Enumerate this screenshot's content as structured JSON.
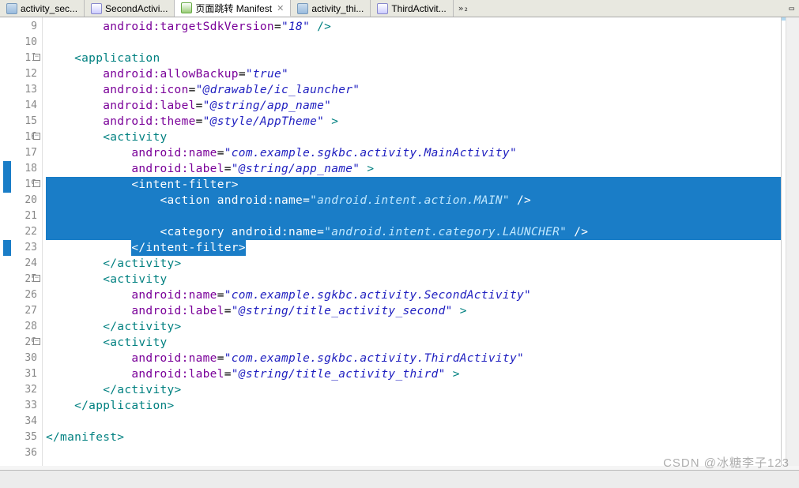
{
  "tabs": [
    {
      "label": "activity_sec...",
      "iconClass": "icon-xml",
      "active": false
    },
    {
      "label": "SecondActivi...",
      "iconClass": "icon-java",
      "active": false
    },
    {
      "label": "页面跳转 Manifest",
      "iconClass": "icon-manifest",
      "active": true,
      "closable": true
    },
    {
      "label": "activity_thi...",
      "iconClass": "icon-xml",
      "active": false
    },
    {
      "label": "ThirdActivit...",
      "iconClass": "icon-java",
      "active": false
    }
  ],
  "overflow_indicator": "»₂",
  "line_start": 9,
  "line_end": 36,
  "fold_lines": [
    11,
    16,
    19,
    25,
    29
  ],
  "blue_markers": [
    18,
    19,
    23
  ],
  "editor": {
    "lines": [
      {
        "n": 9,
        "indent": 2,
        "sel": false,
        "tokens": [
          {
            "t": "attr",
            "v": "android:targetSdkVersion"
          },
          {
            "t": "eq",
            "v": "="
          },
          {
            "t": "str",
            "v": "\"18\""
          },
          {
            "t": "tag",
            "v": " />"
          }
        ]
      },
      {
        "n": 10,
        "indent": 0,
        "sel": false,
        "tokens": []
      },
      {
        "n": 11,
        "indent": 1,
        "sel": false,
        "tokens": [
          {
            "t": "tag",
            "v": "<application"
          }
        ]
      },
      {
        "n": 12,
        "indent": 2,
        "sel": false,
        "tokens": [
          {
            "t": "attr",
            "v": "android:allowBackup"
          },
          {
            "t": "eq",
            "v": "="
          },
          {
            "t": "str",
            "v": "\"true\""
          }
        ]
      },
      {
        "n": 13,
        "indent": 2,
        "sel": false,
        "tokens": [
          {
            "t": "attr",
            "v": "android:icon"
          },
          {
            "t": "eq",
            "v": "="
          },
          {
            "t": "str",
            "v": "\"@drawable/ic_launcher\""
          }
        ]
      },
      {
        "n": 14,
        "indent": 2,
        "sel": false,
        "tokens": [
          {
            "t": "attr",
            "v": "android:label"
          },
          {
            "t": "eq",
            "v": "="
          },
          {
            "t": "str",
            "v": "\"@string/app_name\""
          }
        ]
      },
      {
        "n": 15,
        "indent": 2,
        "sel": false,
        "tokens": [
          {
            "t": "attr",
            "v": "android:theme"
          },
          {
            "t": "eq",
            "v": "="
          },
          {
            "t": "str",
            "v": "\"@style/AppTheme\""
          },
          {
            "t": "tag",
            "v": " >"
          }
        ]
      },
      {
        "n": 16,
        "indent": 2,
        "sel": false,
        "tokens": [
          {
            "t": "tag",
            "v": "<activity"
          }
        ]
      },
      {
        "n": 17,
        "indent": 3,
        "sel": false,
        "tokens": [
          {
            "t": "attr",
            "v": "android:name"
          },
          {
            "t": "eq",
            "v": "="
          },
          {
            "t": "str",
            "v": "\"com.example.sgkbc.activity.MainActivity\""
          }
        ]
      },
      {
        "n": 18,
        "indent": 3,
        "sel": false,
        "tokens": [
          {
            "t": "attr",
            "v": "android:label"
          },
          {
            "t": "eq",
            "v": "="
          },
          {
            "t": "str",
            "v": "\"@string/app_name\""
          },
          {
            "t": "tag",
            "v": " >"
          }
        ]
      },
      {
        "n": 19,
        "indent": 3,
        "sel": true,
        "tokens": [
          {
            "t": "tag",
            "v": "<intent-filter>"
          }
        ]
      },
      {
        "n": 20,
        "indent": 4,
        "sel": true,
        "tokens": [
          {
            "t": "tag",
            "v": "<action "
          },
          {
            "t": "attr",
            "v": "android:name"
          },
          {
            "t": "eq",
            "v": "="
          },
          {
            "t": "str",
            "v": "\"android.intent.action.MAIN\""
          },
          {
            "t": "tag",
            "v": " />"
          }
        ]
      },
      {
        "n": 21,
        "indent": 0,
        "sel": true,
        "tokens": []
      },
      {
        "n": 22,
        "indent": 4,
        "sel": true,
        "tokens": [
          {
            "t": "tag",
            "v": "<category "
          },
          {
            "t": "attr",
            "v": "android:name"
          },
          {
            "t": "eq",
            "v": "="
          },
          {
            "t": "str",
            "v": "\"android.intent.category.LAUNCHER\""
          },
          {
            "t": "tag",
            "v": " />"
          }
        ]
      },
      {
        "n": 23,
        "indent": 3,
        "sel": "partial",
        "tokens": [
          {
            "t": "tag",
            "v": "</intent-filter>"
          }
        ]
      },
      {
        "n": 24,
        "indent": 2,
        "sel": false,
        "tokens": [
          {
            "t": "tag",
            "v": "</activity>"
          }
        ]
      },
      {
        "n": 25,
        "indent": 2,
        "sel": false,
        "tokens": [
          {
            "t": "tag",
            "v": "<activity"
          }
        ]
      },
      {
        "n": 26,
        "indent": 3,
        "sel": false,
        "tokens": [
          {
            "t": "attr",
            "v": "android:name"
          },
          {
            "t": "eq",
            "v": "="
          },
          {
            "t": "str",
            "v": "\"com.example.sgkbc.activity.SecondActivity\""
          }
        ]
      },
      {
        "n": 27,
        "indent": 3,
        "sel": false,
        "tokens": [
          {
            "t": "attr",
            "v": "android:label"
          },
          {
            "t": "eq",
            "v": "="
          },
          {
            "t": "str",
            "v": "\"@string/title_activity_second\""
          },
          {
            "t": "tag",
            "v": " >"
          }
        ]
      },
      {
        "n": 28,
        "indent": 2,
        "sel": false,
        "tokens": [
          {
            "t": "tag",
            "v": "</activity>"
          }
        ]
      },
      {
        "n": 29,
        "indent": 2,
        "sel": false,
        "tokens": [
          {
            "t": "tag",
            "v": "<activity"
          }
        ]
      },
      {
        "n": 30,
        "indent": 3,
        "sel": false,
        "tokens": [
          {
            "t": "attr",
            "v": "android:name"
          },
          {
            "t": "eq",
            "v": "="
          },
          {
            "t": "str",
            "v": "\"com.example.sgkbc.activity.ThirdActivity\""
          }
        ]
      },
      {
        "n": 31,
        "indent": 3,
        "sel": false,
        "tokens": [
          {
            "t": "attr",
            "v": "android:label"
          },
          {
            "t": "eq",
            "v": "="
          },
          {
            "t": "str",
            "v": "\"@string/title_activity_third\""
          },
          {
            "t": "tag",
            "v": " >"
          }
        ]
      },
      {
        "n": 32,
        "indent": 2,
        "sel": false,
        "tokens": [
          {
            "t": "tag",
            "v": "</activity>"
          }
        ]
      },
      {
        "n": 33,
        "indent": 1,
        "sel": false,
        "tokens": [
          {
            "t": "tag",
            "v": "</application>"
          }
        ]
      },
      {
        "n": 34,
        "indent": 0,
        "sel": false,
        "tokens": []
      },
      {
        "n": 35,
        "indent": 0,
        "sel": false,
        "tokens": [
          {
            "t": "tag",
            "v": "</manifest>"
          }
        ]
      },
      {
        "n": 36,
        "indent": 0,
        "sel": false,
        "tokens": []
      }
    ]
  },
  "watermark": "CSDN @冰糖李子123"
}
